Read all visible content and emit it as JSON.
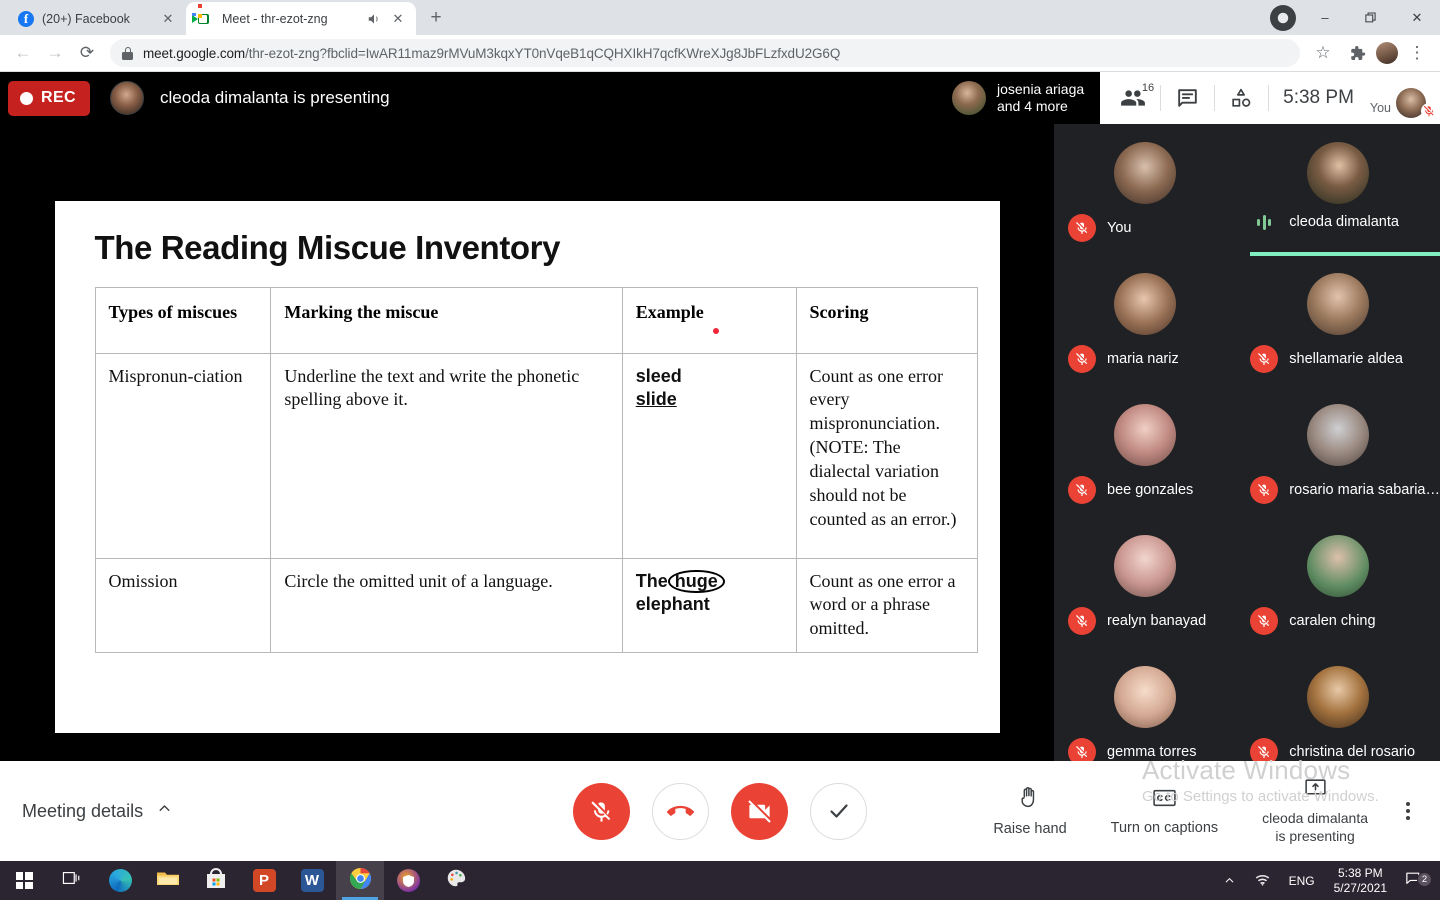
{
  "browser": {
    "tabs": [
      {
        "title": "(20+) Facebook",
        "favicon": "facebook-icon",
        "active": false,
        "audio": false
      },
      {
        "title": "Meet - thr-ezot-zng",
        "favicon": "google-meet-icon",
        "active": true,
        "audio": true
      }
    ],
    "newtab_label": "+",
    "window_controls": {
      "minimize": "–",
      "maximize": "❑",
      "close": "✕"
    },
    "url_host": "meet.google.com",
    "url_path": "/thr-ezot-zng?fbclid=IwAR11maz9rMVuM3kqxYT0nVqeB1qCQHXIkH7qcfKWreXJg8JbFLzfxdU2G6Q",
    "back_label": "←",
    "forward_label": "→",
    "reload_label": "⟳",
    "bookmark_label": "☆",
    "extensions_label": "puzzle",
    "menu_label": "⋮"
  },
  "meet": {
    "recording_label": "REC",
    "presenting_banner": "cleoda dimalanta is presenting",
    "active_speaker_chip": {
      "line1": "josenia ariaga",
      "line2": "and 4 more"
    },
    "people_count": "16",
    "clock": "5:38 PM",
    "you_label": "You",
    "participants": [
      {
        "name": "You",
        "muted": true,
        "speaking": false,
        "avatar": "#c9b6a6"
      },
      {
        "name": "cleoda dimalanta",
        "muted": false,
        "speaking": true,
        "avatar": "#2a2f24"
      },
      {
        "name": "maria nariz",
        "muted": true,
        "speaking": false,
        "avatar": "#d6b6a4"
      },
      {
        "name": "shellamarie aldea",
        "muted": true,
        "speaking": false,
        "avatar": "#cbb0a0"
      },
      {
        "name": "bee gonzales",
        "muted": true,
        "speaking": false,
        "avatar": "#e0b3b0"
      },
      {
        "name": "rosario maria sabaria…",
        "muted": true,
        "speaking": false,
        "avatar": "#c3c3c6"
      },
      {
        "name": "realyn banayad",
        "muted": true,
        "speaking": false,
        "avatar": "#e4c3c2"
      },
      {
        "name": "caralen ching",
        "muted": true,
        "speaking": false,
        "avatar": "#8fae90"
      },
      {
        "name": "gemma torres",
        "muted": true,
        "speaking": false,
        "avatar": "#e9c9bb"
      },
      {
        "name": "christina del rosario",
        "muted": true,
        "speaking": false,
        "avatar": "#c9a88e"
      }
    ],
    "bottom": {
      "meeting_details": "Meeting details",
      "chevron": "∧",
      "controls": [
        {
          "name": "microphone-off-button",
          "state": "off",
          "style": "red"
        },
        {
          "name": "leave-call-button",
          "state": "on",
          "style": "outline"
        },
        {
          "name": "camera-off-button",
          "state": "off",
          "style": "red"
        },
        {
          "name": "confirm-button",
          "state": "on",
          "style": "outline"
        }
      ],
      "raise_hand": "Raise hand",
      "captions": "Turn on captions",
      "present_status_line1": "cleoda dimalanta",
      "present_status_line2": "is presenting",
      "more_options": "⋮"
    },
    "accent_speaking": "#81f0c0",
    "accent_red": "#ea4335",
    "rec_red": "#c5221f"
  },
  "slide": {
    "title": "The Reading Miscue Inventory",
    "columns": [
      "Types of miscues",
      "Marking the miscue",
      "Example",
      "Scoring"
    ],
    "rows": [
      {
        "type": "Mispronun-ciation",
        "marking": "Underline the text and write the phonetic spelling above it.",
        "example_top": "sleed",
        "example_bottom": "slide",
        "example_style": "underline-bottom",
        "scoring": "Count as one error every mispronunciation. (NOTE: The dialectal variation should not be counted as an error.)"
      },
      {
        "type": "Omission",
        "marking": "Circle the omitted unit of a language.",
        "example_top": "The",
        "example_circled": "huge",
        "example_bottom": "elephant",
        "example_style": "circled-word",
        "scoring": "Count as one error a word or a phrase omitted."
      }
    ]
  },
  "watermark": {
    "line1": "Activate Windows",
    "line2": "Go to Settings to activate Windows."
  },
  "taskbar": {
    "items": [
      {
        "name": "start-button",
        "icon": "windows-logo-icon"
      },
      {
        "name": "task-view-button",
        "icon": "task-view-icon"
      },
      {
        "name": "edge-button",
        "icon": "edge-icon"
      },
      {
        "name": "file-explorer-button",
        "icon": "folder-icon"
      },
      {
        "name": "microsoft-store-button",
        "icon": "store-icon"
      },
      {
        "name": "powerpoint-button",
        "icon": "powerpoint-icon"
      },
      {
        "name": "word-button",
        "icon": "word-icon"
      },
      {
        "name": "chrome-button",
        "icon": "chrome-icon",
        "active": true
      },
      {
        "name": "avast-button",
        "icon": "shield-icon"
      },
      {
        "name": "paint-button",
        "icon": "paint-palette-icon"
      }
    ],
    "tray": {
      "chevron": "∧",
      "language": "ENG",
      "time": "5:38 PM",
      "date": "5/27/2021",
      "notification_count": "2"
    }
  }
}
